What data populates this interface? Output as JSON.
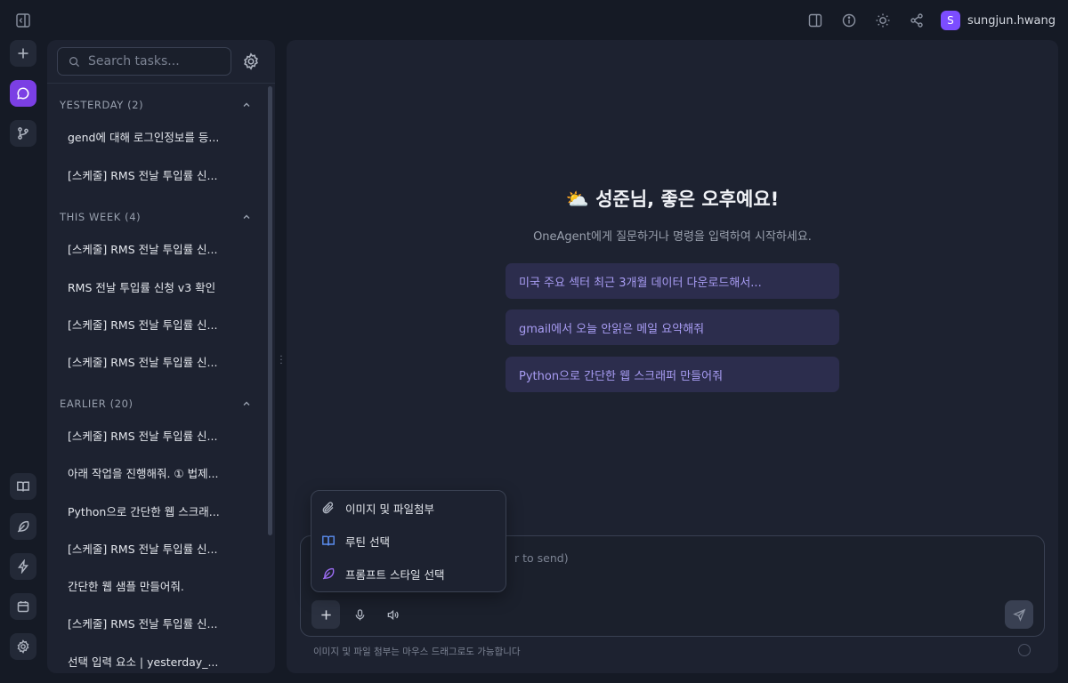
{
  "header": {
    "user": {
      "initial": "S",
      "name": "sungjun.hwang"
    },
    "accent_color": "#7c4dff"
  },
  "sidebar": {
    "search_placeholder": "Search tasks...",
    "groups": [
      {
        "title": "YESTERDAY (2)",
        "items": [
          "gend에 대해 로그인정보를 등...",
          "[스케줄] RMS 전날 투입률 신..."
        ]
      },
      {
        "title": "THIS WEEK (4)",
        "items": [
          "[스케줄] RMS 전날 투입률 신...",
          "RMS 전날 투입률 신청 v3 확인",
          "[스케줄] RMS 전날 투입률 신...",
          "[스케줄] RMS 전날 투입률 신..."
        ]
      },
      {
        "title": "EARLIER (20)",
        "items": [
          "[스케줄] RMS 전날 투입률 신...",
          "아래 작업을 진행해줘. ① 법제...",
          "Python으로 간단한 웹 스크래...",
          "[스케줄] RMS 전날 투입률 신...",
          "간단한 웹 샘플 만들어줘.",
          "[스케줄] RMS 전날 투입률 신...",
          "선택 입력 요소 | yesterday_..."
        ]
      }
    ]
  },
  "main": {
    "greeting": "⛅ 성준님, 좋은 오후예요!",
    "subtitle": "OneAgent에게 질문하거나 명령을 입력하여 시작하세요.",
    "suggestions": [
      "미국 주요 섹터 최근 3개월 데이터 다운로드해서...",
      "gmail에서 오늘 안읽은 메일 요약해줘",
      "Python으로 간단한 웹 스크래퍼 만들어줘"
    ],
    "composer_placeholder_visible": "r to send)",
    "footer_hint": "이미지 및 파일 첨부는 마우스 드래그로도 가능합니다"
  },
  "attach_menu": {
    "items": [
      {
        "label": "이미지 및 파일첨부",
        "icon": "paperclip-icon"
      },
      {
        "label": "루틴 선택",
        "icon": "book-icon"
      },
      {
        "label": "프롬프트 스타일 선택",
        "icon": "feather-icon"
      }
    ]
  }
}
